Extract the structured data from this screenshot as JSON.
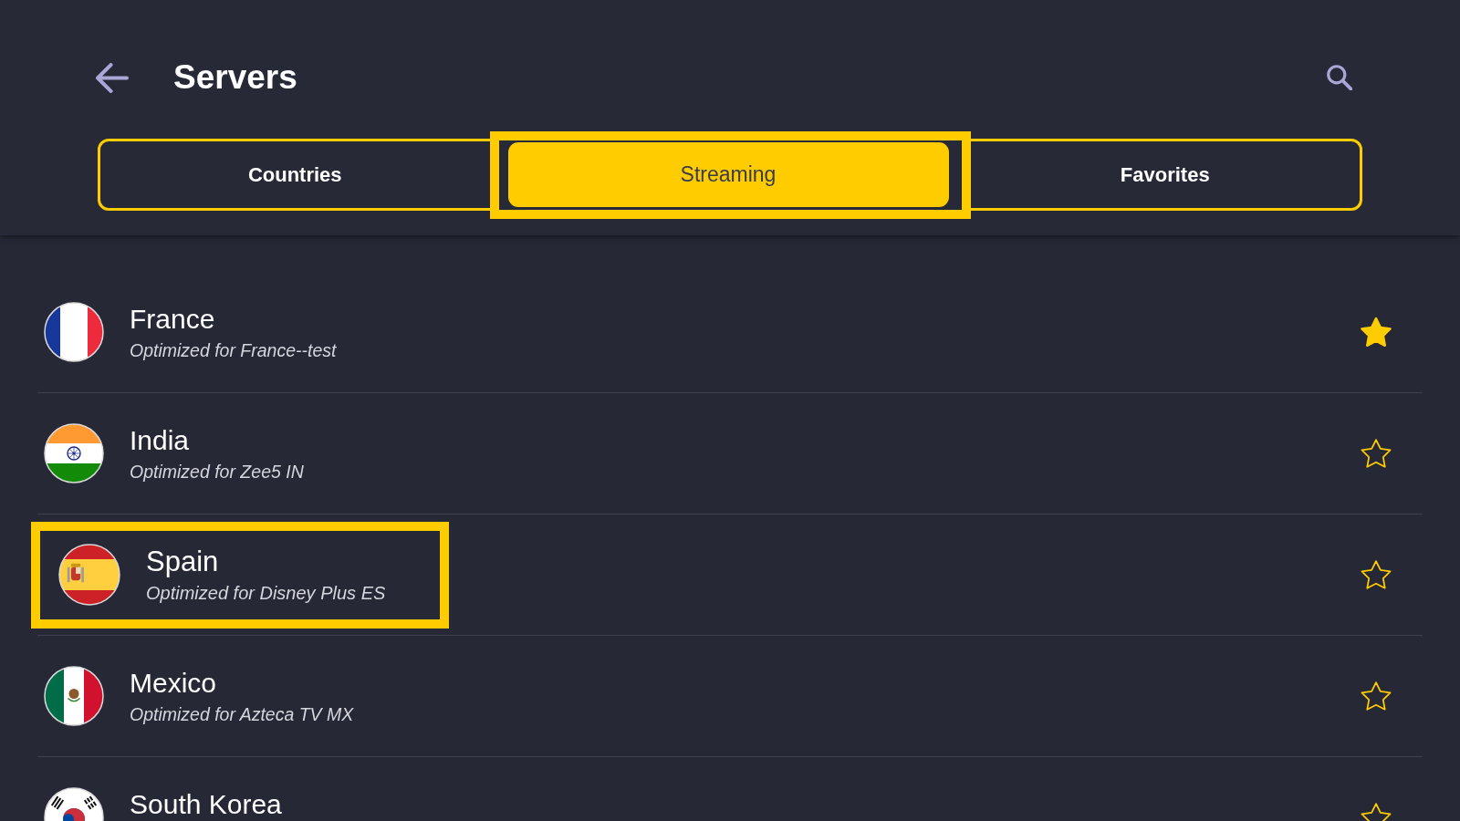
{
  "header": {
    "title": "Servers"
  },
  "tabs": [
    {
      "label": "Countries",
      "selected": false,
      "focused": false
    },
    {
      "label": "Streaming",
      "selected": true,
      "focused": true
    },
    {
      "label": "Favorites",
      "selected": false,
      "focused": false
    }
  ],
  "servers": [
    {
      "kind": "fr",
      "name": "France",
      "subtitle": "Optimized for France--test",
      "favorite": true,
      "focused": false
    },
    {
      "kind": "in",
      "name": "India",
      "subtitle": "Optimized for Zee5 IN",
      "favorite": false,
      "focused": false
    },
    {
      "kind": "es",
      "name": "Spain",
      "subtitle": "Optimized for Disney Plus ES",
      "favorite": false,
      "focused": true
    },
    {
      "kind": "mx",
      "name": "Mexico",
      "subtitle": "Optimized for Azteca TV MX",
      "favorite": false,
      "focused": false
    },
    {
      "kind": "kr",
      "name": "South Korea",
      "favorite": false,
      "focused": false
    }
  ]
}
